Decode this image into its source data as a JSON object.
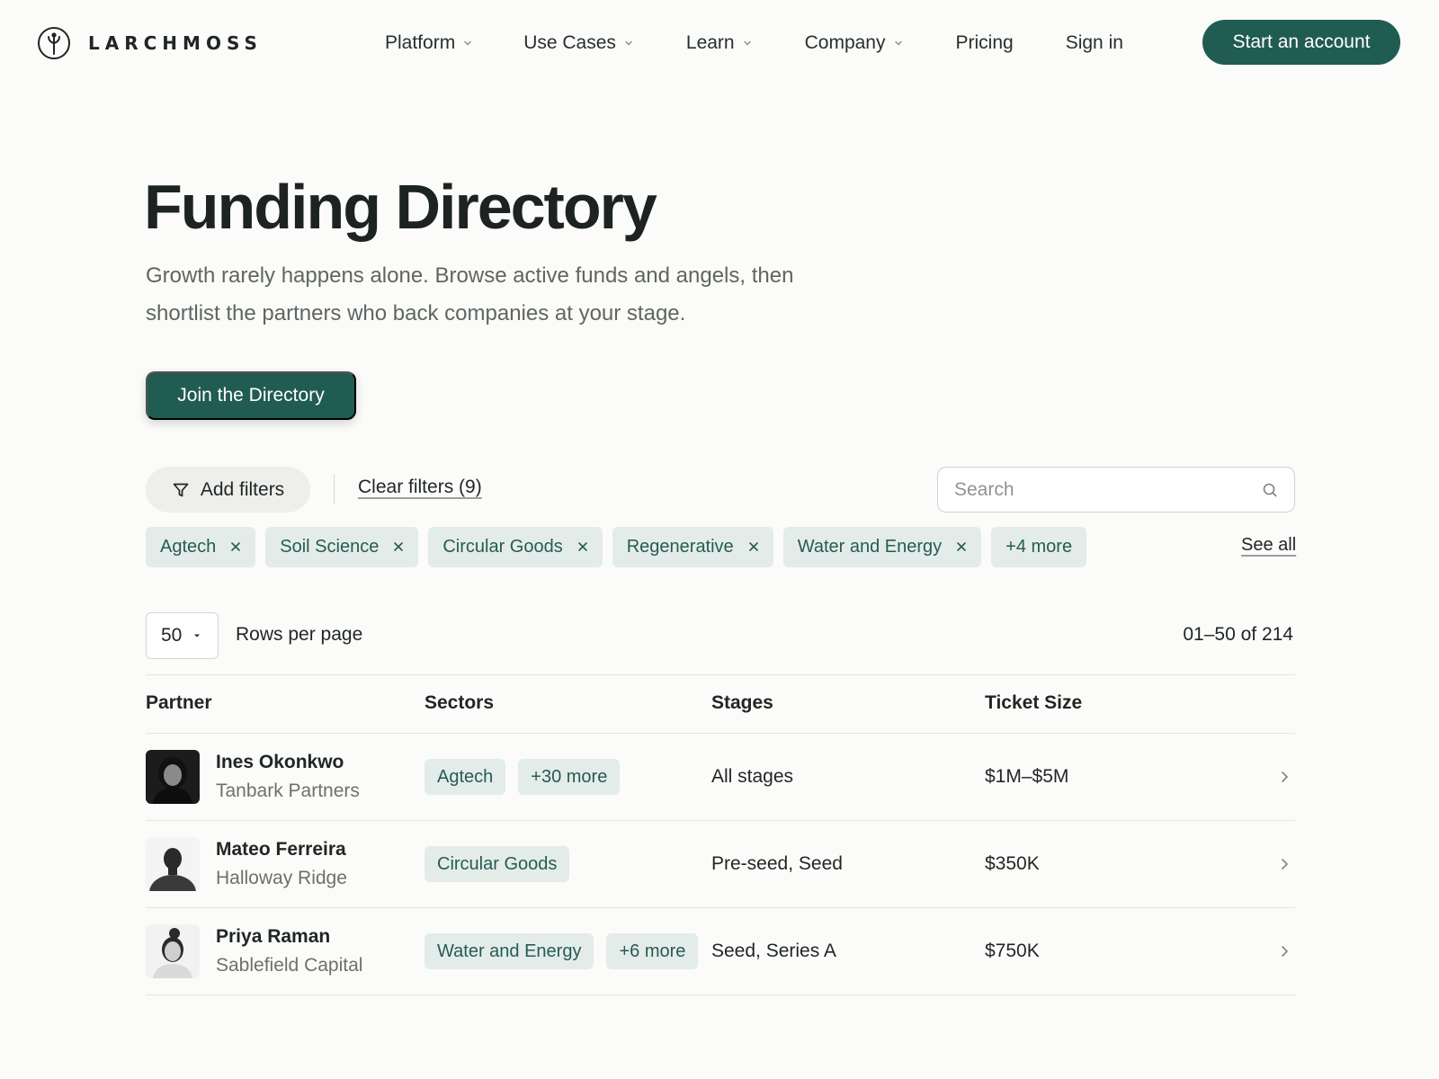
{
  "brand": {
    "name": "LARCHMOSS"
  },
  "nav": {
    "items": [
      {
        "label": "Platform",
        "has_menu": true
      },
      {
        "label": "Use Cases",
        "has_menu": true
      },
      {
        "label": "Learn",
        "has_menu": true
      },
      {
        "label": "Company",
        "has_menu": true
      },
      {
        "label": "Pricing",
        "has_menu": false
      },
      {
        "label": "Sign in",
        "has_menu": false
      }
    ],
    "cta_label": "Start an account"
  },
  "hero": {
    "title": "Funding Directory",
    "subtitle": "Growth rarely happens alone. Browse active funds and angels, then shortlist the partners who back companies at your stage.",
    "button_label": "Join the Directory"
  },
  "filters": {
    "add_label": "Add filters",
    "clear_label": "Clear filters (9)",
    "search_placeholder": "Search",
    "chips": [
      "Agtech",
      "Soil Science",
      "Circular Goods",
      "Regenerative",
      "Water and Energy"
    ],
    "more_label": "+4 more",
    "see_all_label": "See all"
  },
  "pagination": {
    "rows_per_page_value": "50",
    "rows_per_page_label": "Rows per page",
    "range_label": "01–50 of 214"
  },
  "table": {
    "headers": {
      "partner": "Partner",
      "sectors": "Sectors",
      "stages": "Stages",
      "ticket": "Ticket Size"
    },
    "rows": [
      {
        "name": "Ines Okonkwo",
        "org": "Tanbark Partners",
        "sector": "Agtech",
        "sector_more": "+30 more",
        "stages": "All stages",
        "ticket": "$1M–$5M"
      },
      {
        "name": "Mateo Ferreira",
        "org": "Halloway Ridge",
        "sector": "Circular Goods",
        "sector_more": "",
        "stages": "Pre-seed, Seed",
        "ticket": "$350K"
      },
      {
        "name": "Priya Raman",
        "org": "Sablefield Capital",
        "sector": "Water and Energy",
        "sector_more": "+6 more",
        "stages": "Seed, Series A",
        "ticket": "$750K"
      }
    ]
  },
  "colors": {
    "accent": "#215c52",
    "chip_bg": "#e4ecea",
    "chip_text": "#255c52",
    "background": "#fbfbf9"
  }
}
